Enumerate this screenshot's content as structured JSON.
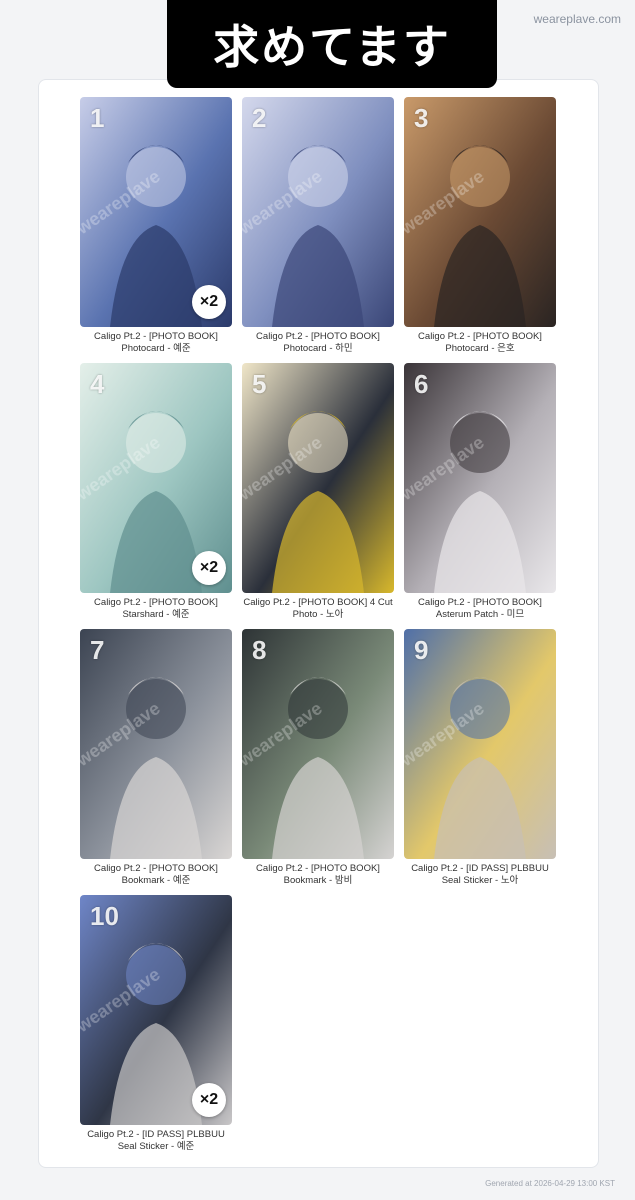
{
  "header": {
    "banner_text": "求めてます",
    "site": "weareplave.com"
  },
  "items": [
    {
      "number": "1",
      "title": "Caligo Pt.2 - [PHOTO BOOK]",
      "subtitle": "Photocard - 예준",
      "watermark": "weareplave",
      "qty": "×2",
      "colors": [
        "#2b3a6a",
        "#5a73b0",
        "#c7cde8"
      ]
    },
    {
      "number": "2",
      "title": "Caligo Pt.2 - [PHOTO BOOK]",
      "subtitle": "Photocard - 하민",
      "watermark": "weareplave",
      "qty": "",
      "colors": [
        "#3a4677",
        "#7f8fbf",
        "#d4d8ec"
      ]
    },
    {
      "number": "3",
      "title": "Caligo Pt.2 - [PHOTO BOOK]",
      "subtitle": "Photocard - 은호",
      "watermark": "weareplave",
      "qty": "",
      "colors": [
        "#2a2422",
        "#6b4a34",
        "#c99a6a"
      ]
    },
    {
      "number": "4",
      "title": "Caligo Pt.2 - [PHOTO BOOK]",
      "subtitle": "Starshard - 예준",
      "watermark": "weareplave",
      "qty": "×2",
      "colors": [
        "#5f8f8f",
        "#9dc6c1",
        "#e4efe9"
      ]
    },
    {
      "number": "5",
      "title": "Caligo Pt.2 - [PHOTO BOOK] 4 Cut",
      "subtitle": "Photo - 노아",
      "watermark": "weareplave",
      "qty": "",
      "colors": [
        "#d8b82c",
        "#2a2f3a",
        "#f0e6c8"
      ]
    },
    {
      "number": "6",
      "title": "Caligo Pt.2 - [PHOTO BOOK]",
      "subtitle": "Asterum Patch - 미므",
      "watermark": "weareplave",
      "qty": "",
      "colors": [
        "#e9e7ea",
        "#b4b0b6",
        "#3a3438"
      ]
    },
    {
      "number": "7",
      "title": "Caligo Pt.2 - [PHOTO BOOK]",
      "subtitle": "Bookmark - 예준",
      "watermark": "weareplave",
      "qty": "",
      "colors": [
        "#d9d6d4",
        "#8c929c",
        "#3c4452"
      ]
    },
    {
      "number": "8",
      "title": "Caligo Pt.2 - [PHOTO BOOK]",
      "subtitle": "Bookmark - 밤비",
      "watermark": "weareplave",
      "qty": "",
      "colors": [
        "#d5d3d2",
        "#7a8a78",
        "#2e3436"
      ]
    },
    {
      "number": "9",
      "title": "Caligo Pt.2 - [ID PASS] PLBBUU",
      "subtitle": "Seal Sticker - 노아",
      "watermark": "weareplave",
      "qty": "",
      "colors": [
        "#c7bfb5",
        "#e3c86a",
        "#4f6fa8"
      ]
    },
    {
      "number": "10",
      "title": "Caligo Pt.2 - [ID PASS] PLBBUU",
      "subtitle": "Seal Sticker - 예준",
      "watermark": "weareplave",
      "qty": "×2",
      "colors": [
        "#c9c7c8",
        "#2f3646",
        "#6f86c8"
      ]
    }
  ],
  "footer": {
    "text": "Generated at 2026-04-29 13:00 KST"
  }
}
